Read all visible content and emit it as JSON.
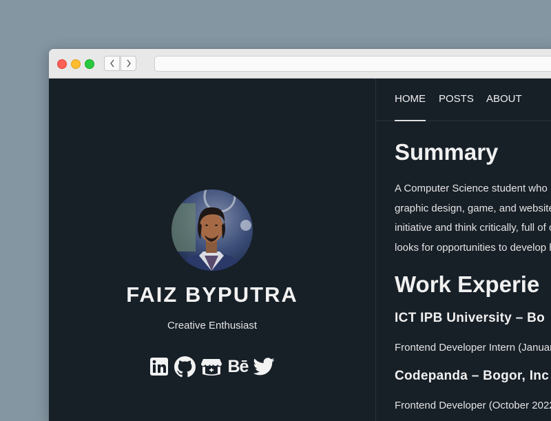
{
  "browser": {
    "address_value": "",
    "back_icon": "chevron-left-icon",
    "forward_icon": "chevron-right-icon"
  },
  "profile": {
    "name": "FAIZ BYPUTRA",
    "tagline": "Creative Enthusiast",
    "avatar_alt": "profile-photo",
    "socials": [
      {
        "icon": "linkedin-icon"
      },
      {
        "icon": "github-icon"
      },
      {
        "icon": "itchio-icon"
      },
      {
        "icon": "behance-icon",
        "text": "Bē"
      },
      {
        "icon": "twitter-icon"
      }
    ]
  },
  "nav": {
    "home": "HOME",
    "posts": "POSTS",
    "about": "ABOUT",
    "active": "HOME"
  },
  "article": {
    "summary_heading": "Summary",
    "summary_lines": [
      "A Computer Science student who p",
      "graphic design, game, and website",
      "initiative and think critically, full of c",
      "looks for opportunities to develop h"
    ],
    "work_heading": "Work Experie",
    "jobs": [
      {
        "title": "ICT IPB University – Bo",
        "role": "Frontend Developer Intern (Januar"
      },
      {
        "title": "Codepanda – Bogor, Inc",
        "role": "Frontend Developer (October 2022"
      }
    ]
  },
  "colors": {
    "desktop": "#8496a2",
    "page_bg": "#171f27",
    "text": "#f0f0f0"
  }
}
